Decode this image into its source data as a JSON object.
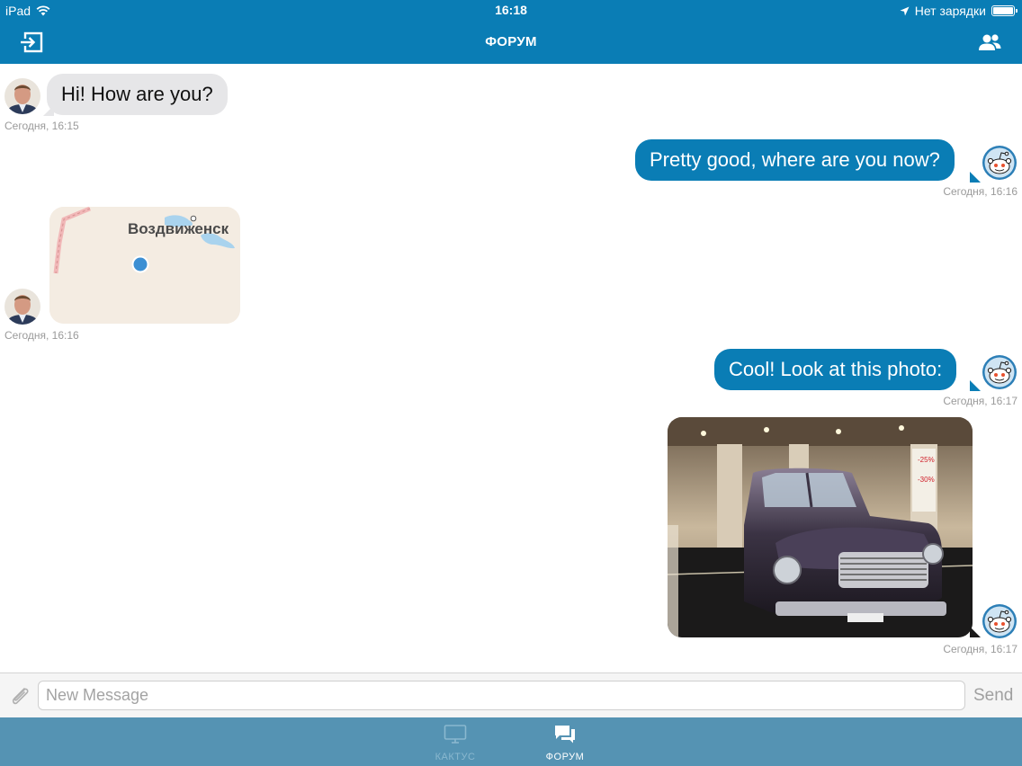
{
  "status_bar": {
    "device": "iPad",
    "time": "16:18",
    "charging": "Нет зарядки",
    "battery_level": 1.0
  },
  "nav": {
    "title": "ФОРУМ",
    "left_icon": "logout-icon",
    "right_icon": "users-icon"
  },
  "colors": {
    "accent": "#0a7db5",
    "tabbar": "#5593b3",
    "incoming_bubble": "#e6e6e8",
    "timestamp": "#9a9a9a"
  },
  "messages": [
    {
      "direction": "incoming",
      "type": "text",
      "text": "Hi! How are you?",
      "timestamp": "Сегодня, 16:15",
      "avatar": "user-photo-avatar"
    },
    {
      "direction": "outgoing",
      "type": "text",
      "text": "Pretty good, where are you now?",
      "timestamp": "Сегодня, 16:16",
      "avatar": "robot-avatar"
    },
    {
      "direction": "incoming",
      "type": "location",
      "map_label": "Воздвиженск",
      "timestamp": "Сегодня, 16:16",
      "avatar": "user-photo-avatar"
    },
    {
      "direction": "outgoing",
      "type": "text",
      "text": "Cool! Look at this photo:",
      "timestamp": "Сегодня, 16:17",
      "avatar": "robot-avatar"
    },
    {
      "direction": "outgoing",
      "type": "image",
      "image": "vintage-car-photo",
      "timestamp": "Сегодня, 16:17",
      "avatar": "robot-avatar"
    }
  ],
  "composer": {
    "placeholder": "New Message",
    "value": "",
    "send_label": "Send",
    "attach_icon": "paperclip-icon"
  },
  "tabs": [
    {
      "label": "КАКТУС",
      "icon": "tv-icon",
      "active": false
    },
    {
      "label": "ФОРУМ",
      "icon": "chat-bubbles-icon",
      "active": true
    }
  ]
}
